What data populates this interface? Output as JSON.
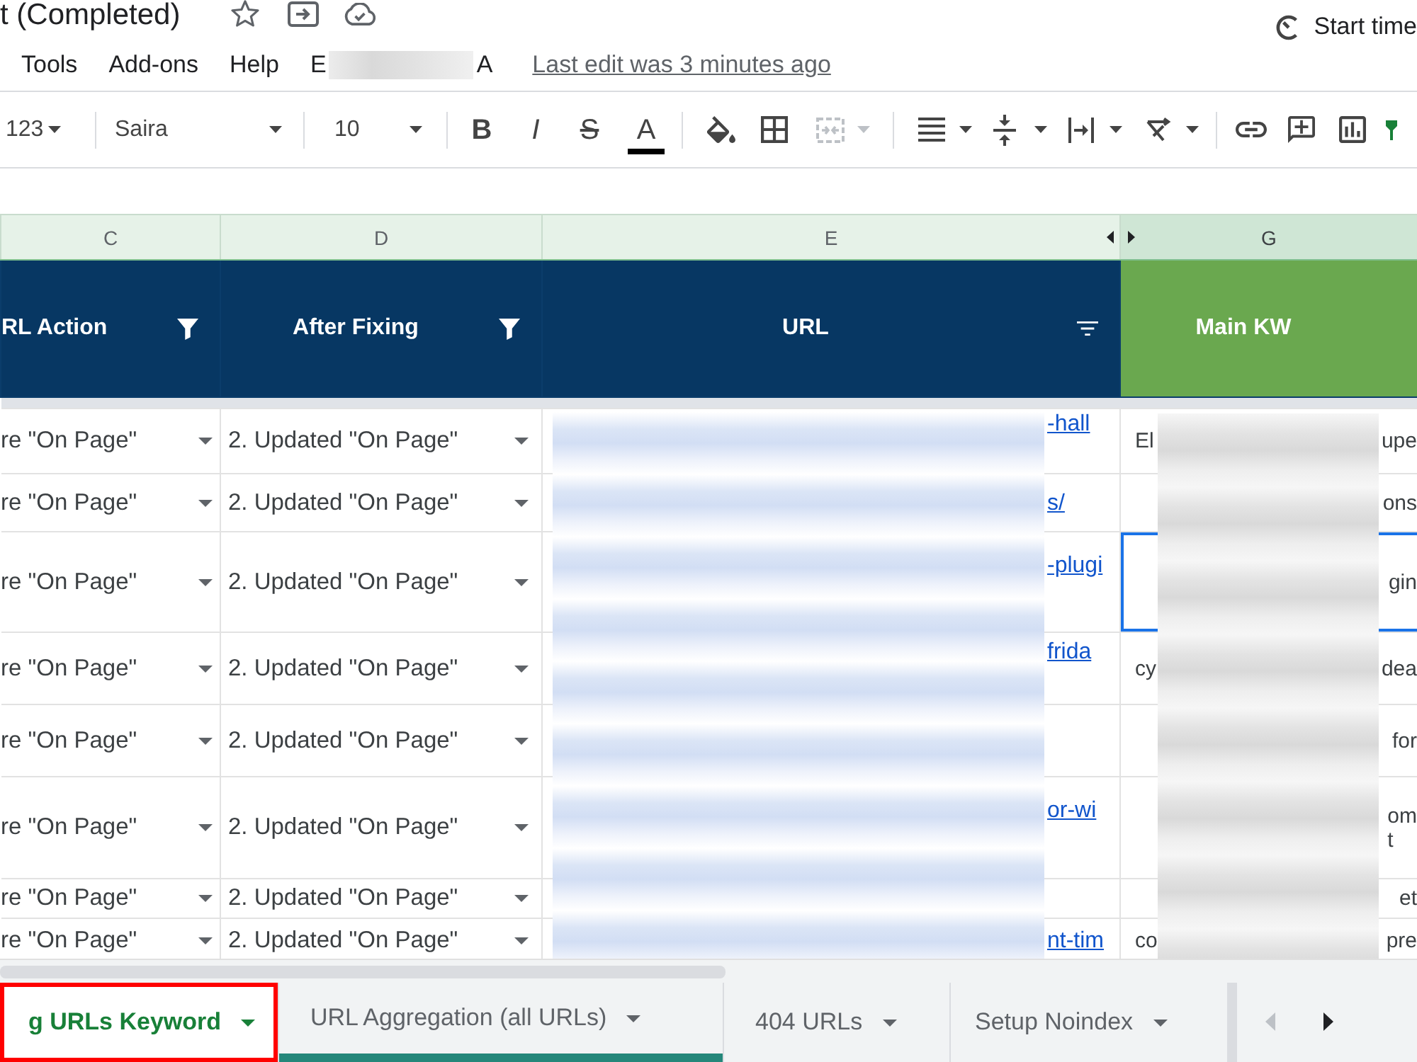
{
  "title_bar": {
    "title": "t (Completed)",
    "starred": false,
    "timer_button": "Start time"
  },
  "menu_bar": {
    "items": [
      "Tools",
      "Add-ons",
      "Help"
    ],
    "redacted_item": {
      "visible_start": "E",
      "visible_end": "A"
    },
    "last_edit": "Last edit was 3 minutes ago"
  },
  "toolbar": {
    "number_format": "123",
    "font": "Saira",
    "font_size": "10",
    "text_styles": [
      {
        "kind": "bold",
        "label": "B"
      },
      {
        "kind": "italic",
        "label": "I"
      },
      {
        "kind": "strikethrough",
        "label": "S"
      },
      {
        "kind": "text_color",
        "label": "A"
      }
    ],
    "merge_cells": {
      "disabled": true
    }
  },
  "columns": [
    {
      "letter": "C",
      "selected": false,
      "hidden_after": false
    },
    {
      "letter": "D",
      "selected": false,
      "hidden_after": false
    },
    {
      "letter": "E",
      "selected": false,
      "hidden_after": true
    },
    {
      "letter": "G",
      "selected": true,
      "hidden_after": false
    }
  ],
  "header": [
    {
      "kind": "filtered",
      "label": "RL Action",
      "color": "#073763"
    },
    {
      "kind": "filtered",
      "label": "After Fixing",
      "color": "#073763"
    },
    {
      "kind": "filterable",
      "label": "URL",
      "color": "#073763"
    },
    {
      "kind": "plain",
      "label": "Main KW",
      "color": "#6aa84f"
    }
  ],
  "rows": [
    {
      "action": "re \"On Page\"",
      "after_fixing": "2. Updated \"On Page\"",
      "url": "-hall",
      "kw_start": "El",
      "kw_end": [
        "upe"
      ],
      "selected": false
    },
    {
      "action": "re \"On Page\"",
      "after_fixing": "2. Updated \"On Page\"",
      "url": "s/",
      "kw_end": [
        "ons"
      ],
      "selected": false
    },
    {
      "action": "re \"On Page\"",
      "after_fixing": "2. Updated \"On Page\"",
      "url": "-plugi",
      "kw_end": [
        "gin"
      ],
      "selected": true
    },
    {
      "action": "re \"On Page\"",
      "after_fixing": "2. Updated \"On Page\"",
      "url": "frida",
      "kw_start": "cy",
      "kw_end": [
        "dea"
      ],
      "selected": false
    },
    {
      "action": "re \"On Page\"",
      "after_fixing": "2. Updated \"On Page\"",
      "kw_end": [
        "for"
      ],
      "selected": false
    },
    {
      "action": "re \"On Page\"",
      "after_fixing": "2. Updated \"On Page\"",
      "url": "or-wi",
      "kw_end": [
        "om",
        "t"
      ],
      "selected": false
    },
    {
      "action": "re \"On Page\"",
      "after_fixing": "2. Updated \"On Page\"",
      "kw_end": [
        "et"
      ],
      "selected": false
    },
    {
      "action": "re \"On Page\"",
      "after_fixing": "2. Updated \"On Page\"",
      "url": "nt-tim",
      "kw_start": "co",
      "kw_end": [
        "pre"
      ],
      "selected": false
    }
  ],
  "sheet_tabs": [
    {
      "label": "g URLs Keyword",
      "selected": true,
      "annotated": true
    },
    {
      "label": "URL Aggregation (all URLs)",
      "selected": false,
      "annotated": false,
      "color": "#25877a"
    },
    {
      "label": "404 URLs",
      "selected": false,
      "annotated": false
    },
    {
      "label": "Setup Noindex",
      "selected": false,
      "annotated": false
    }
  ],
  "tab_scroll": {
    "left": {
      "disabled": true
    },
    "right": {
      "disabled": false
    }
  }
}
